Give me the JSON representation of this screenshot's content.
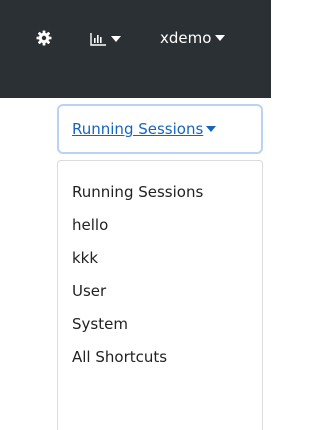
{
  "navbar": {
    "settings_icon": "gear-icon",
    "chart_icon": "bar-chart-icon",
    "user_label": "xdemo"
  },
  "session_selector": {
    "label": "Running Sessions"
  },
  "dropdown": {
    "items": [
      {
        "label": "Running Sessions"
      },
      {
        "label": "hello"
      },
      {
        "label": "kkk"
      },
      {
        "label": "User"
      },
      {
        "label": "System"
      },
      {
        "label": "All Shortcuts"
      }
    ]
  },
  "colors": {
    "navbar_bg": "#2b3035",
    "link_blue": "#1565c0",
    "button_border": "#b9d3f1"
  }
}
